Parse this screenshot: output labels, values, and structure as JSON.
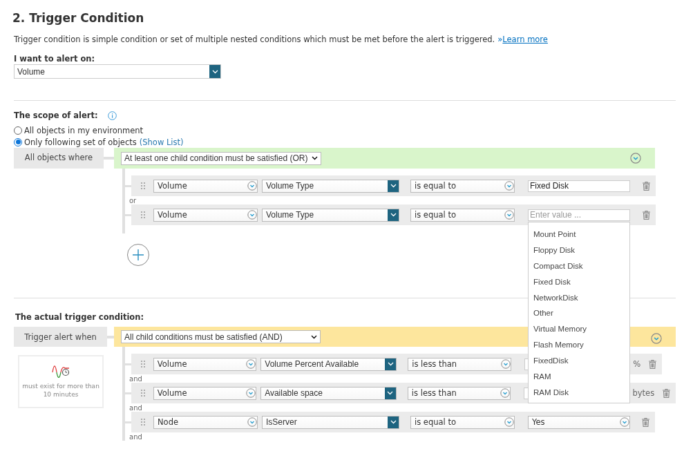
{
  "title": "2. Trigger Condition",
  "description": "Trigger condition is simple condition or set of multiple nested conditions which must be met before the alert is triggered.",
  "learn_more": {
    "marker": "»",
    "label": "Learn more"
  },
  "alert_on": {
    "label": "I want to alert on:",
    "value": "Volume"
  },
  "scope": {
    "label": "The scope of alert:",
    "options": [
      {
        "label": "All objects in my environment",
        "selected": false
      },
      {
        "label": "Only following set of objects",
        "selected": true,
        "link": "(Show List)"
      }
    ],
    "group_label": "All objects where",
    "mode": "At least one child condition must be satisfied (OR)",
    "conditions": [
      {
        "kind": "input",
        "object": "Volume",
        "field": "Volume Type",
        "operator": "is equal to",
        "value": "Fixed Disk",
        "connector": "or"
      },
      {
        "kind": "input",
        "object": "Volume",
        "field": "Volume Type",
        "operator": "is equal to",
        "placeholder": "Enter value ...",
        "suggestions": [
          "Mount Point",
          "Floppy Disk",
          "Compact Disk",
          "Fixed Disk",
          "NetworkDisk",
          "Other",
          "Virtual Memory",
          "Flash Memory",
          "FixedDisk",
          "RAM",
          "RAM Disk"
        ]
      }
    ]
  },
  "trigger": {
    "label": "The actual trigger condition:",
    "group_label": "Trigger alert when",
    "mode": "All child conditions must be satisfied (AND)",
    "duration": "must exist for more than 10 minutes",
    "conditions": [
      {
        "kind": "input",
        "object": "Volume",
        "field": "Volume Percent Available",
        "operator": "is less than",
        "unit": "%",
        "connector": "and"
      },
      {
        "kind": "input",
        "object": "Volume",
        "field": "Available space",
        "operator": "is less than",
        "unit": "bytes",
        "connector": "and"
      },
      {
        "kind": "select",
        "object": "Node",
        "field": "IsServer",
        "operator": "is equal to",
        "value": "Yes",
        "connector": "and"
      }
    ]
  }
}
